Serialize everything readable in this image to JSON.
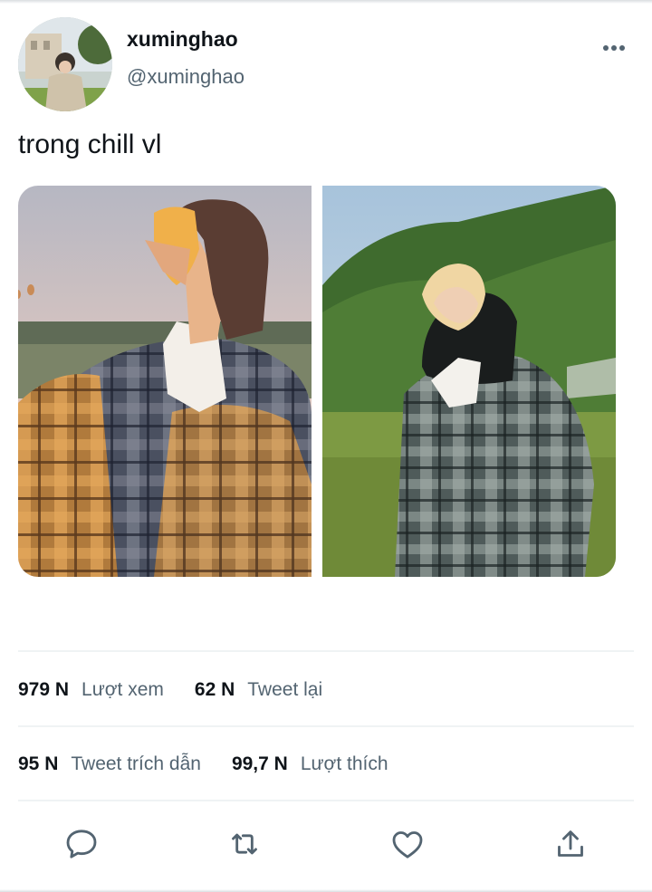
{
  "author": {
    "display_name": "xuminghao",
    "handle": "@xuminghao",
    "avatar_icon": "profile-photo"
  },
  "tweet": {
    "text": "trong chill vl",
    "media": [
      {
        "icon": "photo-sunset-hood"
      },
      {
        "icon": "photo-field-hood"
      }
    ]
  },
  "stats": {
    "views_count": "979 N",
    "views_label": "Lượt xem",
    "retweets_count": "62 N",
    "retweets_label": "Tweet lại",
    "quotes_count": "95 N",
    "quotes_label": "Tweet trích dẫn",
    "likes_count": "99,7 N",
    "likes_label": "Lượt thích"
  },
  "actions": {
    "reply_icon": "reply-icon",
    "retweet_icon": "retweet-icon",
    "like_icon": "heart-icon",
    "share_icon": "share-icon"
  },
  "colors": {
    "text_primary": "#0f1419",
    "text_secondary": "#536471",
    "divider": "#eff3f4"
  }
}
